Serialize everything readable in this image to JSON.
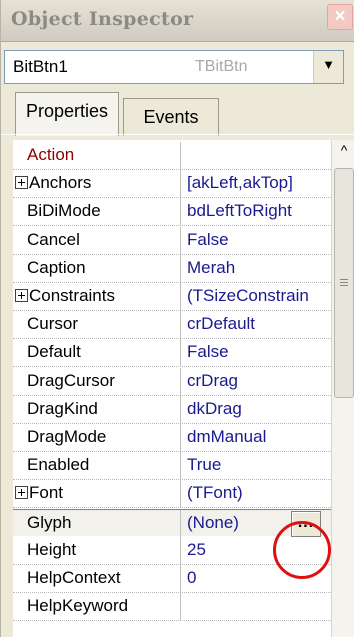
{
  "window": {
    "title": "Object Inspector",
    "close_label": "×"
  },
  "object_selector": {
    "name": "BitBtn1",
    "type": "TBitBtn",
    "dropdown_icon": "chevron-down-icon"
  },
  "tabs": [
    {
      "label": "Properties",
      "active": true
    },
    {
      "label": "Events",
      "active": false
    }
  ],
  "properties": [
    {
      "name": "Action",
      "value": "",
      "expandable": false
    },
    {
      "name": "Anchors",
      "value": "[akLeft,akTop]",
      "expandable": true
    },
    {
      "name": "BiDiMode",
      "value": "bdLeftToRight",
      "expandable": false
    },
    {
      "name": "Cancel",
      "value": "False",
      "expandable": false
    },
    {
      "name": "Caption",
      "value": "Merah",
      "expandable": false
    },
    {
      "name": "Constraints",
      "value": "(TSizeConstrain",
      "expandable": true
    },
    {
      "name": "Cursor",
      "value": "crDefault",
      "expandable": false
    },
    {
      "name": "Default",
      "value": "False",
      "expandable": false
    },
    {
      "name": "DragCursor",
      "value": "crDrag",
      "expandable": false
    },
    {
      "name": "DragKind",
      "value": "dkDrag",
      "expandable": false
    },
    {
      "name": "DragMode",
      "value": "dmManual",
      "expandable": false
    },
    {
      "name": "Enabled",
      "value": "True",
      "expandable": false
    },
    {
      "name": "Font",
      "value": "(TFont)",
      "expandable": true
    },
    {
      "name": "Glyph",
      "value": "(None)",
      "expandable": false,
      "selected": true
    },
    {
      "name": "Height",
      "value": "25",
      "expandable": false
    },
    {
      "name": "HelpContext",
      "value": "0",
      "expandable": false
    },
    {
      "name": "HelpKeyword",
      "value": "",
      "expandable": false
    }
  ],
  "editor_button": {
    "label": "...",
    "icon": "ellipsis-icon"
  },
  "colors": {
    "value_text": "#1a1a8e",
    "highlight_property": "#900000",
    "annotation": "#e01010"
  }
}
